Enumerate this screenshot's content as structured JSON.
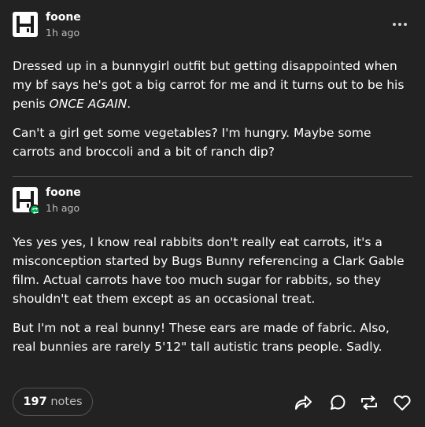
{
  "original_post": {
    "username": "foone",
    "timestamp": "1h ago",
    "paragraph1": "Dressed up in a bunnygirl outfit but getting disappointed when my bf says he's got a big carrot for me and it turns out to be his penis ",
    "paragraph1_emphasis": "ONCE AGAIN",
    "paragraph1_end": ".",
    "paragraph2": "Can't a girl get some vegetables? I'm hungry. Maybe some carrots and broccoli and a bit of ranch dip?"
  },
  "reblog": {
    "username": "foone",
    "timestamp": "1h ago",
    "paragraph1": "Yes yes yes, I know real rabbits don't really eat carrots, it's a misconception started by Bugs Bunny referencing a Clark Gable film. Actual carrots have too much sugar for rabbits, so they shouldn't eat them except as an occasional treat.",
    "paragraph2": "But I'm not a real bunny! These ears are made of fabric. Also, real bunnies are rarely 5'12\" tall autistic trans people. Sadly."
  },
  "footer": {
    "notes_count": "197",
    "notes_label": "notes"
  },
  "icons": {
    "more": "more-horizontal-icon",
    "share": "share-icon",
    "reply": "reply-bubble-icon",
    "reblog": "reblog-icon",
    "like": "heart-icon",
    "reblog_badge": "reblog-badge-icon"
  },
  "colors": {
    "background": "#222222",
    "text": "#ffffff",
    "muted": "#bdbdbd",
    "badge_green": "#00b85c",
    "divider": "#4a4a4a"
  }
}
